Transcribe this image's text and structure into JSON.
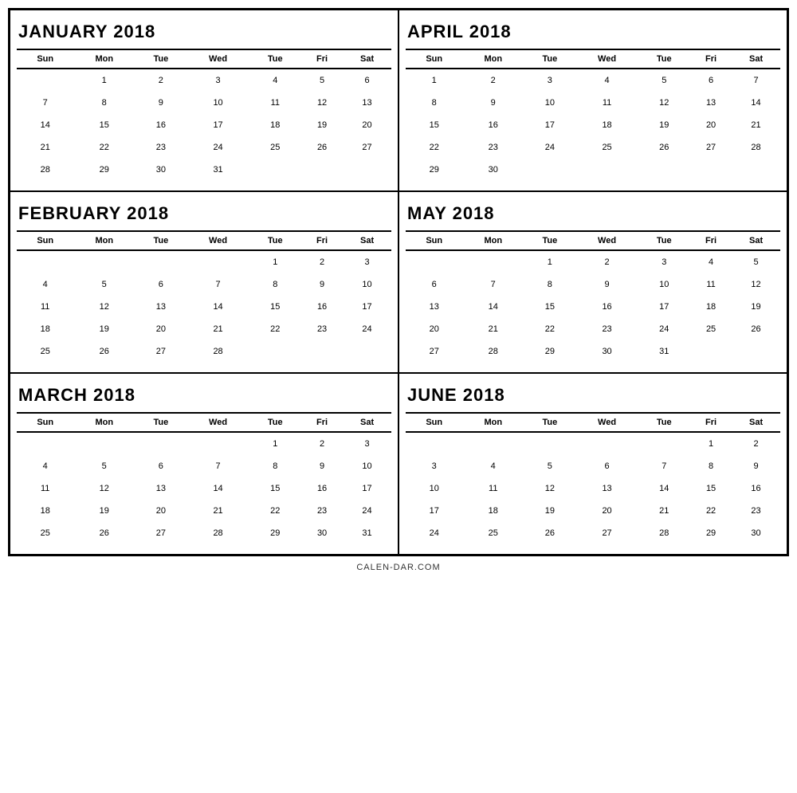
{
  "footer": "CALEN-DAR.COM",
  "months": [
    {
      "id": "january-2018",
      "title": "JANUARY 2018",
      "headers": [
        "Sun",
        "Mon",
        "Tue",
        "Wed",
        "Tue",
        "Fri",
        "Sat"
      ],
      "weeks": [
        [
          "",
          "1",
          "2",
          "3",
          "4",
          "5",
          "6"
        ],
        [
          "7",
          "8",
          "9",
          "10",
          "11",
          "12",
          "13"
        ],
        [
          "14",
          "15",
          "16",
          "17",
          "18",
          "19",
          "20"
        ],
        [
          "21",
          "22",
          "23",
          "24",
          "25",
          "26",
          "27"
        ],
        [
          "28",
          "29",
          "30",
          "31",
          "",
          "",
          ""
        ]
      ]
    },
    {
      "id": "april-2018",
      "title": "APRIL 2018",
      "headers": [
        "Sun",
        "Mon",
        "Tue",
        "Wed",
        "Tue",
        "Fri",
        "Sat"
      ],
      "weeks": [
        [
          "1",
          "2",
          "3",
          "4",
          "5",
          "6",
          "7"
        ],
        [
          "8",
          "9",
          "10",
          "11",
          "12",
          "13",
          "14"
        ],
        [
          "15",
          "16",
          "17",
          "18",
          "19",
          "20",
          "21"
        ],
        [
          "22",
          "23",
          "24",
          "25",
          "26",
          "27",
          "28"
        ],
        [
          "29",
          "30",
          "",
          "",
          "",
          "",
          ""
        ]
      ]
    },
    {
      "id": "february-2018",
      "title": "FEBRUARY 2018",
      "headers": [
        "Sun",
        "Mon",
        "Tue",
        "Wed",
        "Tue",
        "Fri",
        "Sat"
      ],
      "weeks": [
        [
          "",
          "",
          "",
          "",
          "1",
          "2",
          "3"
        ],
        [
          "4",
          "5",
          "6",
          "7",
          "8",
          "9",
          "10"
        ],
        [
          "11",
          "12",
          "13",
          "14",
          "15",
          "16",
          "17"
        ],
        [
          "18",
          "19",
          "20",
          "21",
          "22",
          "23",
          "24"
        ],
        [
          "25",
          "26",
          "27",
          "28",
          "",
          "",
          ""
        ]
      ]
    },
    {
      "id": "may-2018",
      "title": "MAY 2018",
      "headers": [
        "Sun",
        "Mon",
        "Tue",
        "Wed",
        "Tue",
        "Fri",
        "Sat"
      ],
      "weeks": [
        [
          "",
          "",
          "1",
          "2",
          "3",
          "4",
          "5"
        ],
        [
          "6",
          "7",
          "8",
          "9",
          "10",
          "11",
          "12"
        ],
        [
          "13",
          "14",
          "15",
          "16",
          "17",
          "18",
          "19"
        ],
        [
          "20",
          "21",
          "22",
          "23",
          "24",
          "25",
          "26"
        ],
        [
          "27",
          "28",
          "29",
          "30",
          "31",
          "",
          ""
        ]
      ]
    },
    {
      "id": "march-2018",
      "title": "MARCH 2018",
      "headers": [
        "Sun",
        "Mon",
        "Tue",
        "Wed",
        "Tue",
        "Fri",
        "Sat"
      ],
      "weeks": [
        [
          "",
          "",
          "",
          "",
          "1",
          "2",
          "3"
        ],
        [
          "4",
          "5",
          "6",
          "7",
          "8",
          "9",
          "10"
        ],
        [
          "11",
          "12",
          "13",
          "14",
          "15",
          "16",
          "17"
        ],
        [
          "18",
          "19",
          "20",
          "21",
          "22",
          "23",
          "24"
        ],
        [
          "25",
          "26",
          "27",
          "28",
          "29",
          "30",
          "31"
        ]
      ]
    },
    {
      "id": "june-2018",
      "title": "JUNE 2018",
      "headers": [
        "Sun",
        "Mon",
        "Tue",
        "Wed",
        "Tue",
        "Fri",
        "Sat"
      ],
      "weeks": [
        [
          "",
          "",
          "",
          "",
          "",
          "1",
          "2"
        ],
        [
          "3",
          "4",
          "5",
          "6",
          "7",
          "8",
          "9"
        ],
        [
          "10",
          "11",
          "12",
          "13",
          "14",
          "15",
          "16"
        ],
        [
          "17",
          "18",
          "19",
          "20",
          "21",
          "22",
          "23"
        ],
        [
          "24",
          "25",
          "26",
          "27",
          "28",
          "29",
          "30"
        ]
      ]
    }
  ]
}
